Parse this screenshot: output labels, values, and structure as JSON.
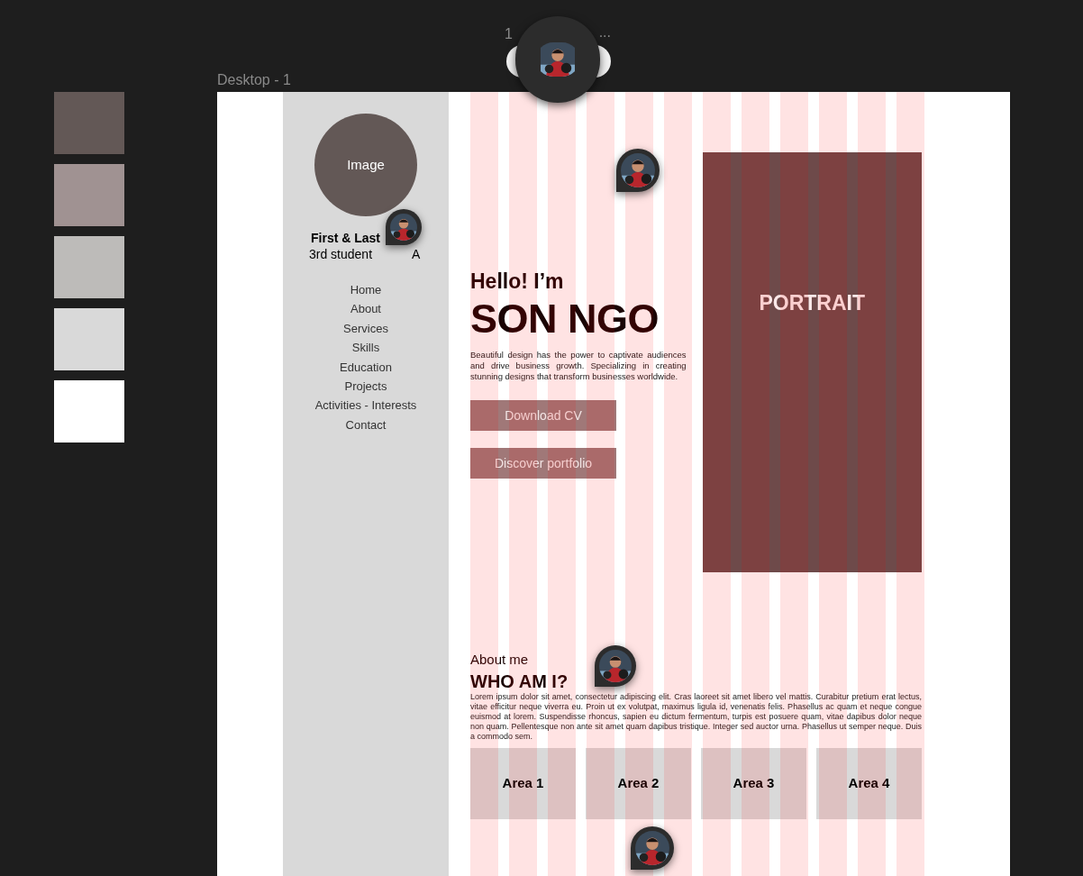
{
  "toolbar": {
    "text_start": "1",
    "text_end": "..."
  },
  "swatches": [
    {
      "color": "#635856"
    },
    {
      "color": "#a09292"
    },
    {
      "color": "#bdbbb9"
    },
    {
      "color": "#d9d9d9"
    },
    {
      "color": "#ffffff"
    }
  ],
  "frame": {
    "title": "Desktop - 1"
  },
  "sidebar": {
    "image_label": "Image",
    "name": "First & Last",
    "subtitle_start": "3rd student",
    "subtitle_end": "A",
    "nav": [
      "Home",
      "About",
      "Services",
      "Skills",
      "Education",
      "Projects",
      "Activities - Interests",
      "Contact"
    ]
  },
  "hero": {
    "greeting": "Hello! I’m",
    "name": "SON NGO",
    "description": "Beautiful design has the power to captivate audiences and drive business growth. Specializing in creating stunning designs that transform businesses worldwide.",
    "buttons": [
      "Download CV",
      "Discover portfolio"
    ],
    "portrait_label": "PORTRAIT"
  },
  "about": {
    "eyebrow": "About me",
    "heading": "WHO AM I?",
    "paragraph": "Lorem ipsum dolor sit amet, consectetur adipiscing elit. Cras laoreet sit amet libero vel mattis. Curabitur pretium erat lectus, vitae efficitur neque viverra eu. Proin ut ex volutpat, maximus ligula id, venenatis felis. Phasellus ac quam et neque congue euismod at lorem. Suspendisse rhoncus, sapien eu dictum fermentum, turpis est posuere quam, vitae dapibus dolor neque non quam. Pellentesque non ante sit amet quam dapibus tristique. Integer sed auctor urna. Phasellus ut semper neque. Duis a commodo sem.",
    "areas": [
      "Area 1",
      "Area 2",
      "Area 3",
      "Area 4"
    ]
  }
}
